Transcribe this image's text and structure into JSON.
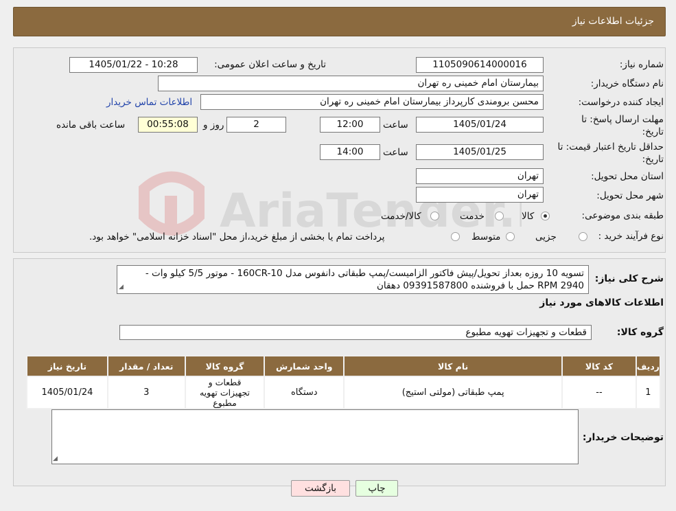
{
  "header": {
    "title": "جزئیات اطلاعات نیاز"
  },
  "info": {
    "need_number_label": "شماره نیاز:",
    "need_number": "1105090614000016",
    "announce_label": "تاریخ و ساعت اعلان عمومی:",
    "announce_value": "1405/01/22 - 10:28",
    "buyer_label": "نام دستگاه خریدار:",
    "buyer_value": "بیمارستان امام خمینی ره  تهران",
    "creator_label": "ایجاد کننده درخواست:",
    "creator_value": "محسن برومندی کارپرداز بیمارستان امام خمینی ره  تهران",
    "contact_link": "اطلاعات تماس خریدار",
    "deadline_label_1": "مهلت ارسال پاسخ: تا",
    "deadline_label_2": "تاریخ:",
    "deadline_date": "1405/01/24",
    "time_label": "ساعت",
    "deadline_time": "12:00",
    "days_value": "2",
    "days_label": "روز و",
    "remaining_value": "00:55:08",
    "remaining_label": "ساعت باقی مانده",
    "validity_label_1": "حداقل تاریخ اعتبار قیمت: تا",
    "validity_label_2": "تاریخ:",
    "validity_date": "1405/01/25",
    "validity_time_label": "ساعت",
    "validity_time": "14:00",
    "province_label": "استان محل تحویل:",
    "province_value": "تهران",
    "city_label": "شهر محل تحویل:",
    "city_value": "تهران",
    "category_label": "طبقه بندی موضوعی:",
    "category_options": [
      "کالا",
      "خدمت",
      "کالا/خدمت"
    ],
    "process_label": "نوع فرآیند خرید :",
    "process_options": [
      "جزیی",
      "متوسط"
    ],
    "process_note": "پرداخت تمام یا بخشی از مبلغ خرید،از محل \"اسناد خزانه اسلامی\" خواهد بود."
  },
  "description": {
    "label": "شرح کلی نیاز:",
    "line1": "تسویه 10 روزه بعداز تحویل/پیش فاکتور الزامیست/پمپ طبقاتی دانفوس مدل 160CR-10 - موتور 5/5 کیلو وات -",
    "line2": "2940 RPM حمل با فروشنده 09391587800 دهقان"
  },
  "goods": {
    "section_title": "اطلاعات کالاهای مورد نیاز",
    "group_label": "گروه کالا:",
    "group_value": "قطعات و تجهیزات تهویه مطبوع",
    "columns": [
      "ردیف",
      "کد کالا",
      "نام کالا",
      "واحد شمارش",
      "گروه کالا",
      "تعداد / مقدار",
      "تاریخ نیاز"
    ],
    "rows": [
      [
        "1",
        "--",
        "پمپ طبقاتی (مولتی استیج)",
        "دستگاه",
        "قطعات و تجهیزات تهویه مطبوع",
        "3",
        "1405/01/24"
      ]
    ]
  },
  "buyer_notes": {
    "label": "توضیحات خریدار:",
    "value": ""
  },
  "buttons": {
    "print": "چاپ",
    "back": "بازگشت"
  },
  "watermark": {
    "text": "AriaTender.neT"
  },
  "colors": {
    "header_bg": "#8b6a3f",
    "link": "#2244aa",
    "remaining_bg": "#ffffd6",
    "back_bg": "#ffe0e0",
    "print_bg": "#e6ffe0"
  }
}
